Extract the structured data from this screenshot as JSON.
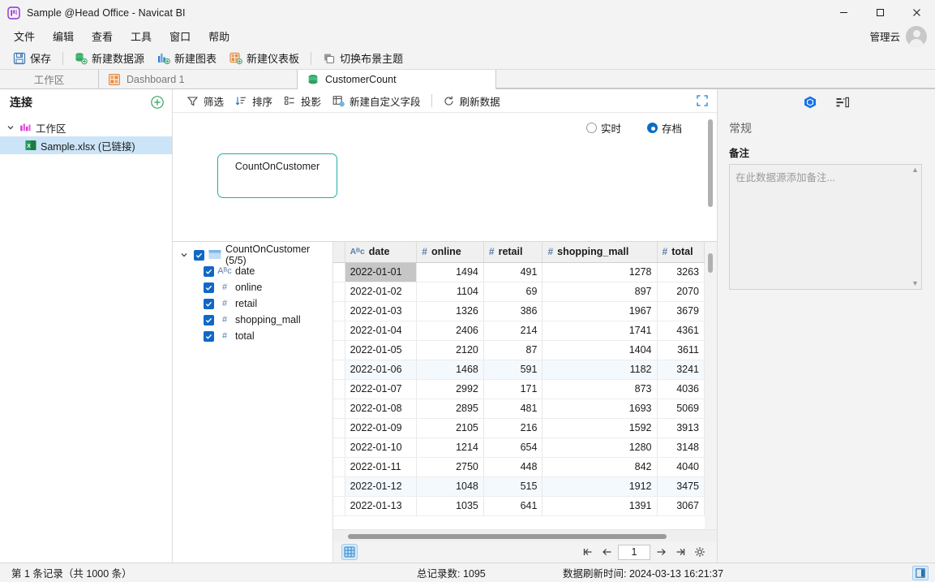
{
  "window": {
    "title": "Sample @Head Office - Navicat BI",
    "logo_icon": "navicat-bi-logo-icon",
    "minimize_label": "─",
    "maximize_label": "□",
    "close_label": "✕"
  },
  "menu": {
    "items": [
      {
        "label": "文件"
      },
      {
        "label": "编辑"
      },
      {
        "label": "查看"
      },
      {
        "label": "工具"
      },
      {
        "label": "窗口"
      },
      {
        "label": "帮助"
      }
    ],
    "account_label": "管理云"
  },
  "toolbar": {
    "save_label": "保存",
    "new_datasource_label": "新建数据源",
    "new_chart_label": "新建图表",
    "new_dashboard_label": "新建仪表板",
    "switch_theme_label": "切换布景主题"
  },
  "tabs": [
    {
      "label": "工作区",
      "active": false,
      "icon": "none"
    },
    {
      "label": "Dashboard 1",
      "active": false,
      "icon": "dashboard-icon"
    },
    {
      "label": "CustomerCount",
      "active": true,
      "icon": "datasource-icon"
    }
  ],
  "sidebar": {
    "title": "连接",
    "add_icon": "add-connection-icon",
    "tree": [
      {
        "label": "工作区",
        "icon": "workspace-icon",
        "expanded": true,
        "selected": false
      },
      {
        "label": "Sample.xlsx (已链接)",
        "icon": "excel-icon",
        "selected": true
      }
    ]
  },
  "datasource_toolbar": {
    "filter_label": "筛选",
    "sort_label": "排序",
    "projection_label": "投影",
    "new_custom_field_label": "新建自定义字段",
    "refresh_label": "刷新数据",
    "fullscreen_icon": "fullscreen-icon"
  },
  "canvas": {
    "mode_realtime_label": "实时",
    "mode_archive_label": "存档",
    "mode_selected": "archive",
    "entity_label": "CountOnCustomer"
  },
  "field_panel": {
    "root": {
      "label": "CountOnCustomer (5/5)",
      "checked": true,
      "expanded": true
    },
    "fields": [
      {
        "label": "date",
        "type_icon": "text-type-icon",
        "type_glyph": "Aᴮᴄ",
        "checked": true
      },
      {
        "label": "online",
        "type_icon": "number-type-icon",
        "type_glyph": "#",
        "checked": true
      },
      {
        "label": "retail",
        "type_icon": "number-type-icon",
        "type_glyph": "#",
        "checked": true
      },
      {
        "label": "shopping_mall",
        "type_icon": "number-type-icon",
        "type_glyph": "#",
        "checked": true
      },
      {
        "label": "total",
        "type_icon": "number-type-icon",
        "type_glyph": "#",
        "checked": true
      }
    ]
  },
  "grid": {
    "columns": [
      {
        "key": "date",
        "label": "date",
        "type_glyph": "Aᴮᴄ",
        "align": "left"
      },
      {
        "key": "online",
        "label": "online",
        "type_glyph": "#",
        "align": "right"
      },
      {
        "key": "retail",
        "label": "retail",
        "type_glyph": "#",
        "align": "right"
      },
      {
        "key": "shopping_mall",
        "label": "shopping_mall",
        "type_glyph": "#",
        "align": "right"
      },
      {
        "key": "total",
        "label": "total",
        "type_glyph": "#",
        "align": "right"
      }
    ],
    "rows": [
      {
        "date": "2022-01-01",
        "online": "1494",
        "retail": "491",
        "shopping_mall": "1278",
        "total": "3263",
        "selected": true
      },
      {
        "date": "2022-01-02",
        "online": "1104",
        "retail": "69",
        "shopping_mall": "897",
        "total": "2070",
        "selected": false
      },
      {
        "date": "2022-01-03",
        "online": "1326",
        "retail": "386",
        "shopping_mall": "1967",
        "total": "3679",
        "selected": false
      },
      {
        "date": "2022-01-04",
        "online": "2406",
        "retail": "214",
        "shopping_mall": "1741",
        "total": "4361",
        "selected": false
      },
      {
        "date": "2022-01-05",
        "online": "2120",
        "retail": "87",
        "shopping_mall": "1404",
        "total": "3611",
        "selected": false
      },
      {
        "date": "2022-01-06",
        "online": "1468",
        "retail": "591",
        "shopping_mall": "1182",
        "total": "3241",
        "selected": false
      },
      {
        "date": "2022-01-07",
        "online": "2992",
        "retail": "171",
        "shopping_mall": "873",
        "total": "4036",
        "selected": false
      },
      {
        "date": "2022-01-08",
        "online": "2895",
        "retail": "481",
        "shopping_mall": "1693",
        "total": "5069",
        "selected": false
      },
      {
        "date": "2022-01-09",
        "online": "2105",
        "retail": "216",
        "shopping_mall": "1592",
        "total": "3913",
        "selected": false
      },
      {
        "date": "2022-01-10",
        "online": "1214",
        "retail": "654",
        "shopping_mall": "1280",
        "total": "3148",
        "selected": false
      },
      {
        "date": "2022-01-11",
        "online": "2750",
        "retail": "448",
        "shopping_mall": "842",
        "total": "4040",
        "selected": false
      },
      {
        "date": "2022-01-12",
        "online": "1048",
        "retail": "515",
        "shopping_mall": "1912",
        "total": "3475",
        "selected": false
      },
      {
        "date": "2022-01-13",
        "online": "1035",
        "retail": "641",
        "shopping_mall": "1391",
        "total": "3067",
        "selected": false
      }
    ]
  },
  "pager": {
    "first_icon": "first-page-icon",
    "prev_icon": "prev-page-icon",
    "page_value": "1",
    "next_icon": "next-page-icon",
    "last_icon": "last-page-icon",
    "settings_icon": "gear-icon",
    "grid_mode_icon": "grid-view-icon"
  },
  "right_panel": {
    "tab_object_icon": "object-cube-icon",
    "tab_fields_icon": "fields-list-icon",
    "section_title": "常规",
    "note_label": "备注",
    "note_value": "",
    "note_placeholder": "在此数据源添加备注...",
    "scroll_up_glyph": "▲",
    "scroll_down_glyph": "▼"
  },
  "statusbar": {
    "record_position": "第 1 条记录（共 1000 条）",
    "total_records": "总记录数: 1095",
    "refresh_time": "数据刷新时间: 2024-03-13 16:21:37",
    "panel_toggle_icon": "toggle-right-panel-icon"
  },
  "colors": {
    "accent": "#0a6cc4",
    "entity_border": "#25ada5",
    "selection": "#cce4f7",
    "chrome": "#f3f3f3"
  }
}
